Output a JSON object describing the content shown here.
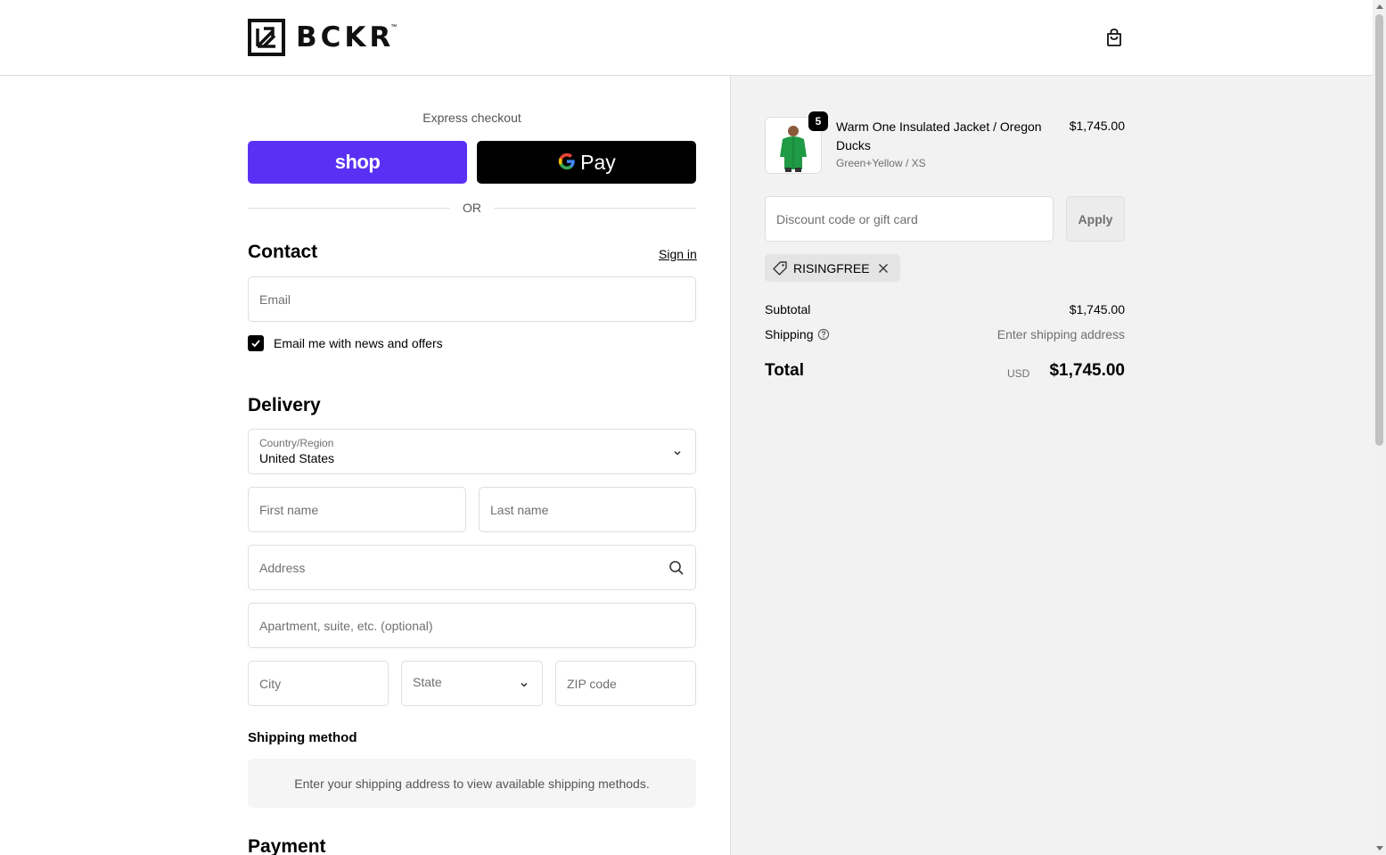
{
  "header": {
    "brand": "BCKR",
    "trademark": "™",
    "cart_icon": "shopping-bag-icon"
  },
  "express": {
    "label": "Express checkout",
    "shop_label": "shop",
    "gpay_g": "G",
    "gpay_label": "Pay",
    "or_label": "OR"
  },
  "contact": {
    "heading": "Contact",
    "sign_in": "Sign in",
    "email_placeholder": "Email",
    "newsletter_label": "Email me with news and offers",
    "newsletter_checked": true
  },
  "delivery": {
    "heading": "Delivery",
    "country_label": "Country/Region",
    "country_value": "United States",
    "first_name_placeholder": "First name",
    "last_name_placeholder": "Last name",
    "address_placeholder": "Address",
    "apartment_placeholder": "Apartment, suite, etc. (optional)",
    "city_placeholder": "City",
    "state_placeholder": "State",
    "zip_placeholder": "ZIP code"
  },
  "shipping_method": {
    "heading": "Shipping method",
    "message": "Enter your shipping address to view available shipping methods."
  },
  "payment": {
    "heading": "Payment"
  },
  "summary": {
    "item": {
      "quantity": "5",
      "name": "Warm One Insulated Jacket / Oregon Ducks",
      "variant": "Green+Yellow / XS",
      "price": "$1,745.00"
    },
    "discount_placeholder": "Discount code or gift card",
    "apply_label": "Apply",
    "applied_code": "RISINGFREE",
    "subtotal_label": "Subtotal",
    "subtotal_value": "$1,745.00",
    "shipping_label": "Shipping",
    "shipping_value": "Enter shipping address",
    "total_label": "Total",
    "currency": "USD",
    "total_value": "$1,745.00"
  },
  "colors": {
    "shop_pay": "#5a31f4",
    "gpay": "#000000",
    "summary_bg": "#f2f2f2",
    "border": "#dedede"
  }
}
